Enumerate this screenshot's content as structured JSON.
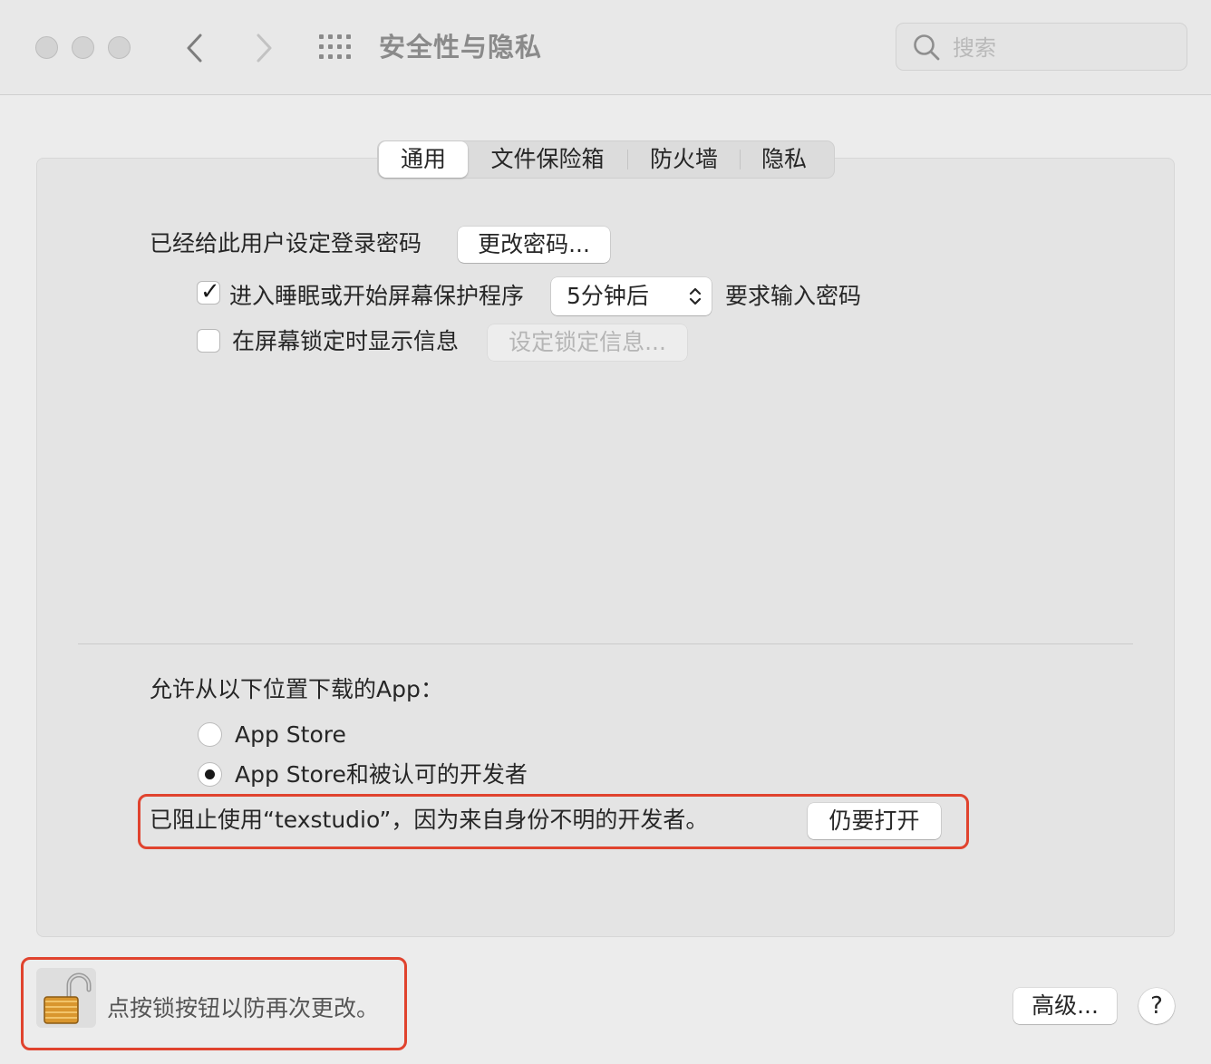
{
  "window": {
    "title": "安全性与隐私",
    "search_placeholder": "搜索"
  },
  "tabs": [
    {
      "label": "通用",
      "active": true
    },
    {
      "label": "文件保险箱",
      "active": false
    },
    {
      "label": "防火墙",
      "active": false
    },
    {
      "label": "隐私",
      "active": false
    }
  ],
  "general": {
    "password_set_label": "已经给此用户设定登录密码",
    "change_password_button": "更改密码...",
    "require_password": {
      "checked": true,
      "label_before": "进入睡眠或开始屏幕保护程序",
      "delay_value": "5分钟后",
      "label_after": "要求输入密码"
    },
    "lock_message": {
      "checked": false,
      "label": "在屏幕锁定时显示信息",
      "button": "设定锁定信息..."
    },
    "allow_apps": {
      "heading": "允许从以下位置下载的App：",
      "options": [
        {
          "label": "App Store",
          "selected": false
        },
        {
          "label": "App Store和被认可的开发者",
          "selected": true
        }
      ]
    },
    "blocked_notice": {
      "text": "已阻止使用“texstudio”，因为来自身份不明的开发者。",
      "button": "仍要打开"
    }
  },
  "footer": {
    "lock_text": "点按锁按钮以防再次更改。",
    "advanced_button": "高级...",
    "help_button": "?"
  },
  "colors": {
    "highlight": "#e0432e",
    "lock": "#d9962e"
  }
}
